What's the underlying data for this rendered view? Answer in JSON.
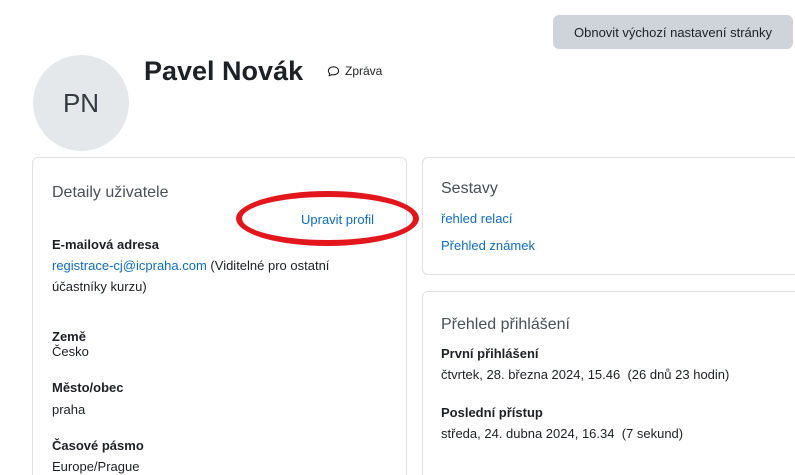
{
  "page": {
    "reset_button": "Obnovit výchozí nastavení stránky"
  },
  "profile": {
    "initials": "PN",
    "name": "Pavel Novák",
    "message_label": "Zpráva"
  },
  "user_details": {
    "title": "Detaily uživatele",
    "edit_profile": "Upravit profil",
    "email_label": "E-mailová adresa",
    "email_value": "registrace-cj@icpraha.com",
    "email_note": " (Viditelné pro ostatní",
    "email_note_line2": "účastníky kurzu)",
    "country_label": "Země",
    "country_value": "Česko",
    "city_label": "Město/obec",
    "city_value": "praha",
    "timezone_label": "Časové pásmo",
    "timezone_value": "Europe/Prague"
  },
  "reports": {
    "title": "Sestavy",
    "sessions": "řehled relací",
    "grades": "Přehled známek"
  },
  "login_overview": {
    "title": "Přehled přihlášení",
    "first_label": "První přihlášení",
    "first_value": "čtvrtek, 28. března 2024, 15.46  (26 dnů 23 hodin)",
    "last_label": "Poslední přístup",
    "last_value": "středa, 24. dubna 2024, 16.34  (7 sekund)"
  },
  "annotation": {
    "color": "#e3161c"
  }
}
